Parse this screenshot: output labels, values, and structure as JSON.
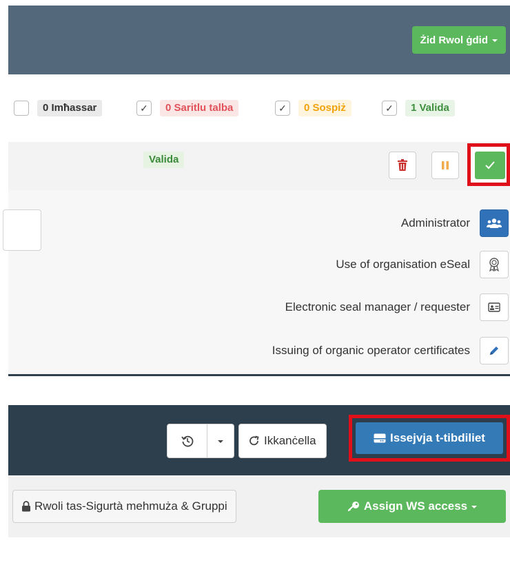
{
  "panel_roles": {
    "add_role_button": "Żid Rwol ġdid",
    "filters": [
      {
        "label": "0 Imħassar",
        "checked": false,
        "color": "#333333"
      },
      {
        "label": "0 Saritlu talba",
        "checked": true,
        "color": "#e2525a"
      },
      {
        "label": "0 Sospiż",
        "checked": true,
        "color": "#f0a20b"
      },
      {
        "label": "1 Valida",
        "checked": true,
        "color": "#3e8e3e"
      }
    ],
    "status_badge": "Valida",
    "action_icons": [
      "trash-icon",
      "pause-icon",
      "check-icon"
    ],
    "roles": [
      {
        "label": "Administrator",
        "icon": "users-icon",
        "active": true
      },
      {
        "label": "Use of organisation eSeal",
        "icon": "award-icon",
        "active": false
      },
      {
        "label": "Electronic seal manager / requester",
        "icon": "id-card-icon",
        "active": false
      },
      {
        "label": "Issuing of organic operator certificates",
        "icon": "pencil-icon",
        "active": false
      }
    ]
  },
  "panel_toolbar": {
    "cancel_button": "Ikkanċella",
    "save_button": "Issejvja t-tibdiliet",
    "security_button": "Rwoli tas-Sigurtà mehmuża & Gruppi",
    "ws_button": "Assign WS access"
  },
  "colors": {
    "success": "#5cb85c",
    "primary": "#337ab7",
    "highlight": "#e0101a",
    "header_dark": "#2d3e4d",
    "header_slate": "#53687a"
  }
}
